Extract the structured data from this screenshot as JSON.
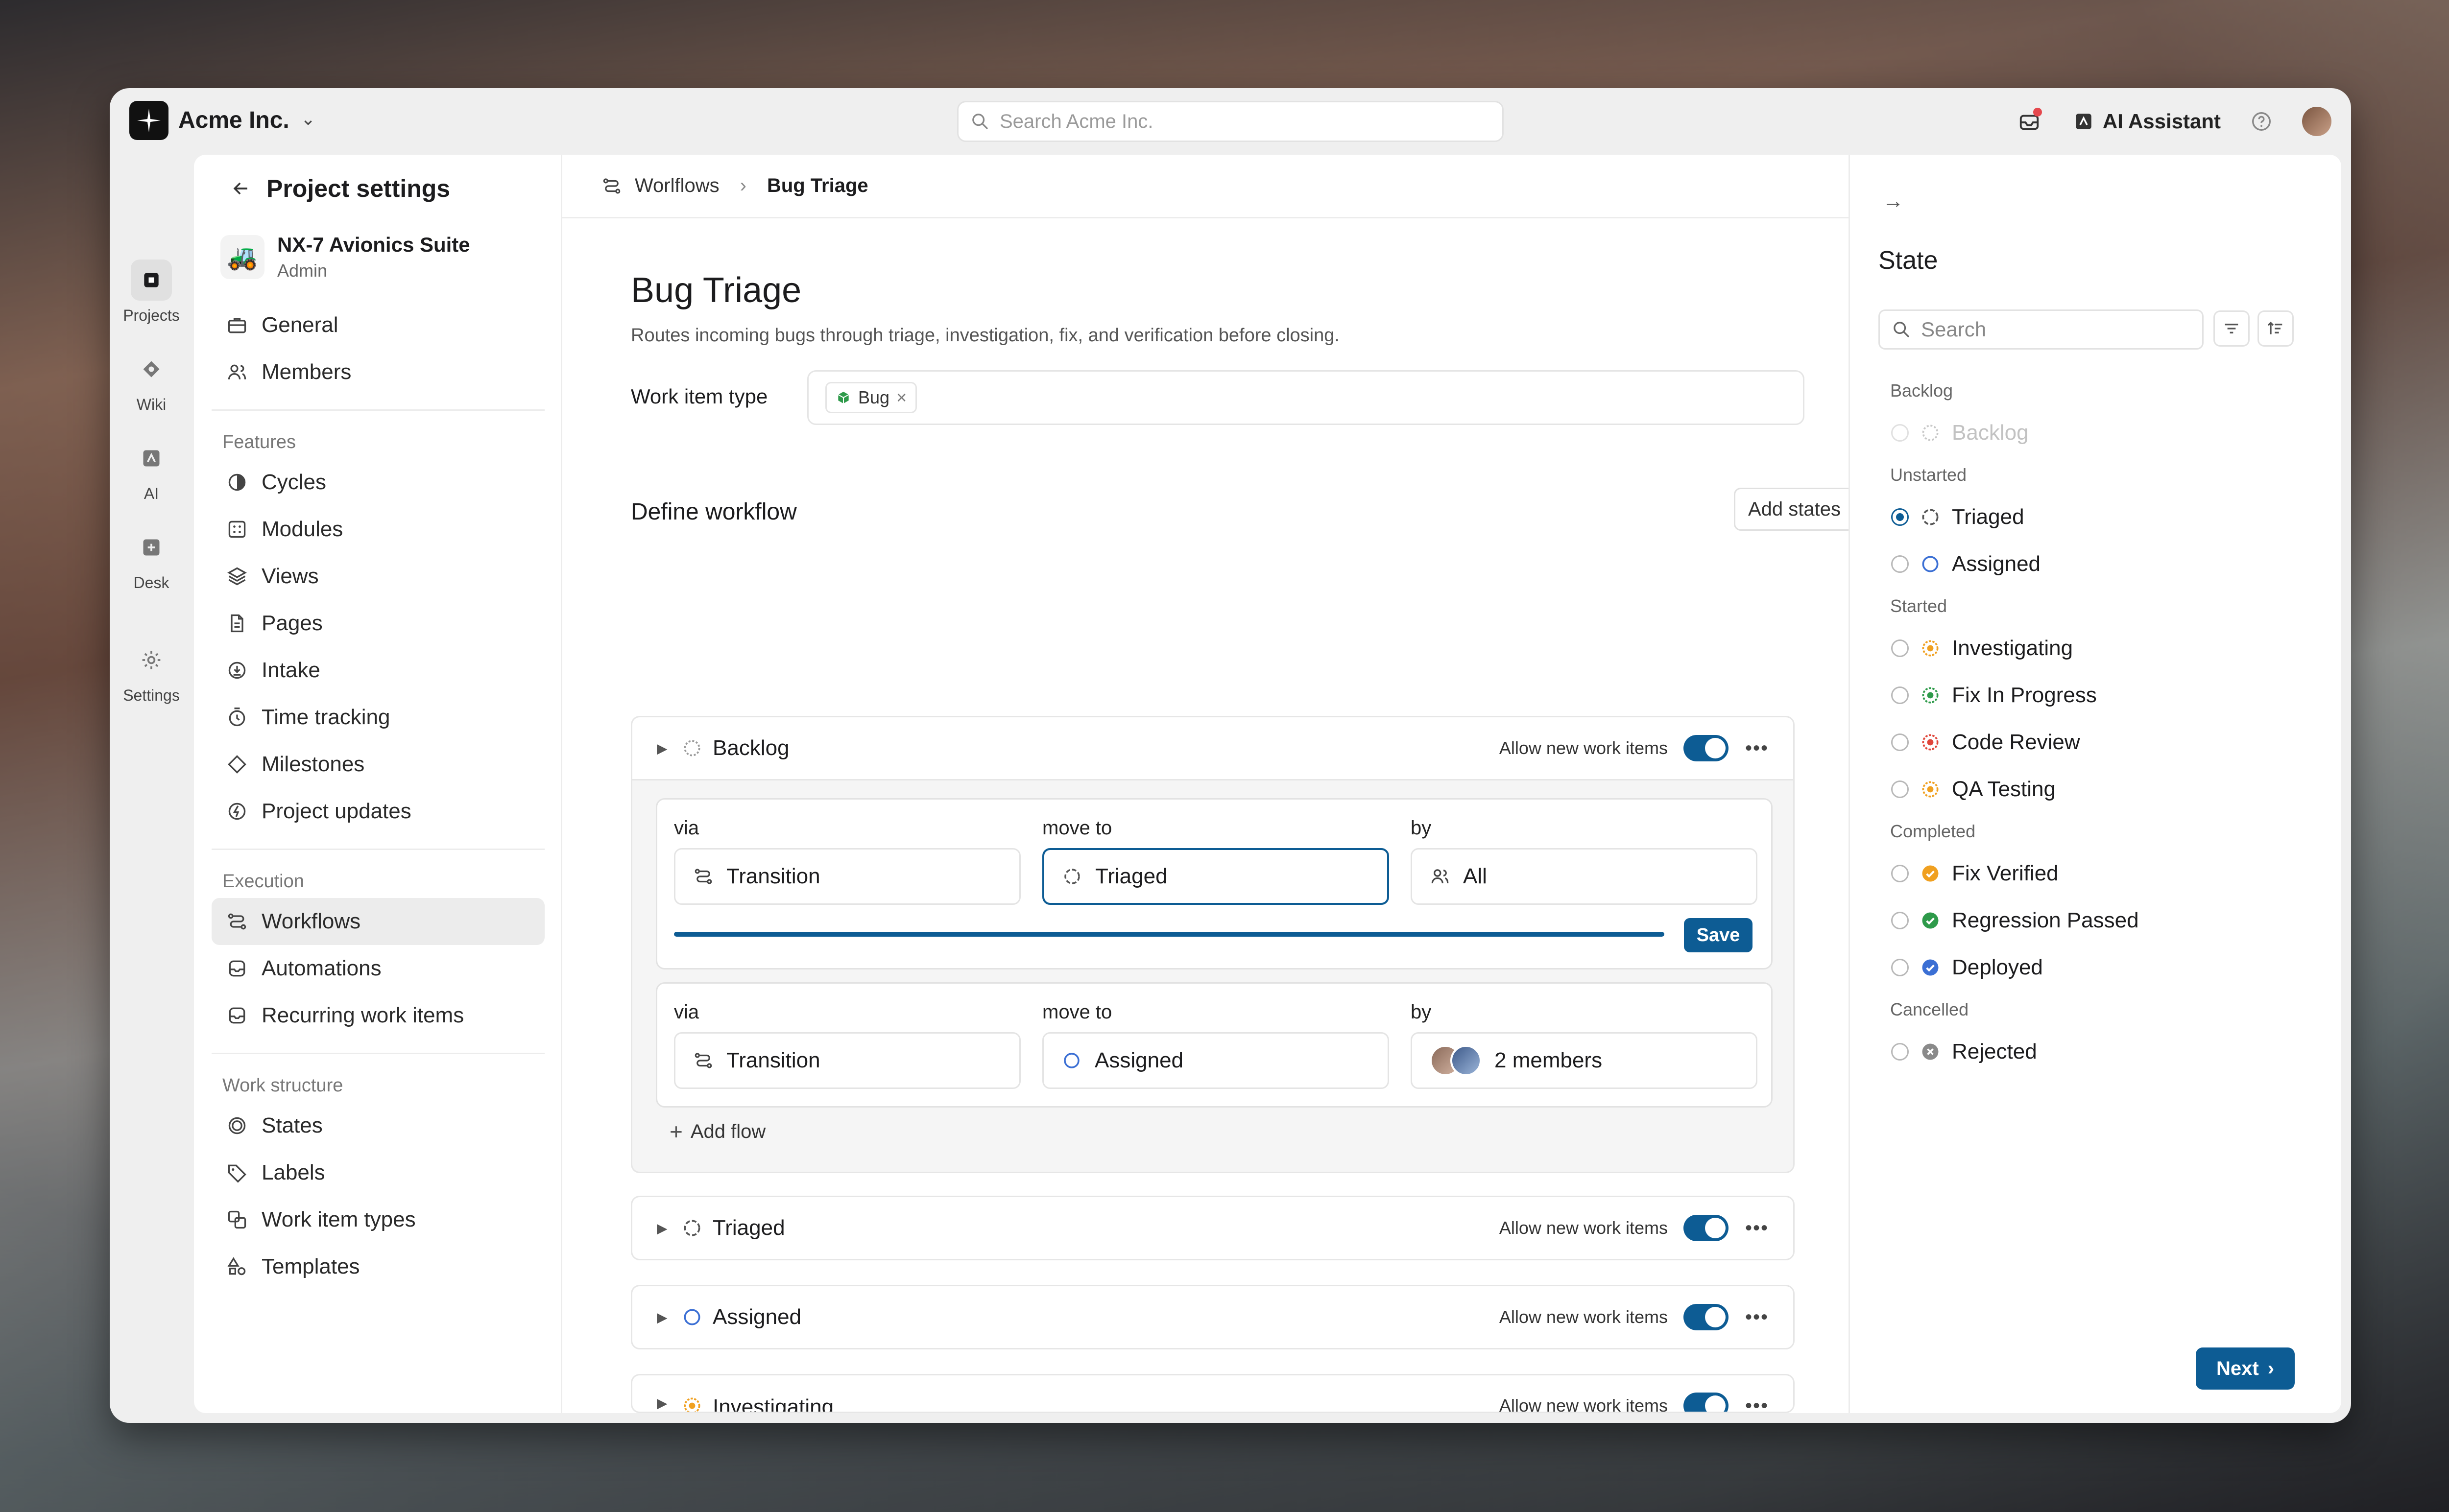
{
  "workspace": {
    "name": "Acme Inc."
  },
  "top_search": {
    "placeholder": "Search Acme Inc."
  },
  "top_right": {
    "ai_label": "AI Assistant"
  },
  "rail": [
    {
      "label": "Projects",
      "icon": "projects-icon",
      "active": true
    },
    {
      "label": "Wiki",
      "icon": "wiki-icon"
    },
    {
      "label": "AI",
      "icon": "ai-icon"
    },
    {
      "label": "Desk",
      "icon": "desk-icon"
    },
    {
      "label": "Settings",
      "icon": "settings-icon"
    }
  ],
  "sidebar": {
    "header": "Project settings",
    "project": {
      "name": "NX-7 Avionics Suite",
      "role": "Admin",
      "icon": "tractor-emoji"
    },
    "top_items": [
      "General",
      "Members"
    ],
    "features_label": "Features",
    "features": [
      "Cycles",
      "Modules",
      "Views",
      "Pages",
      "Intake",
      "Time tracking",
      "Milestones",
      "Project updates"
    ],
    "execution_label": "Execution",
    "execution": [
      "Workflows",
      "Automations",
      "Recurring work items"
    ],
    "structure_label": "Work structure",
    "structure": [
      "States",
      "Labels",
      "Work item types",
      "Templates"
    ]
  },
  "breadcrumb": {
    "parent": "Worlflows",
    "current": "Bug Triage"
  },
  "page": {
    "title": "Bug Triage",
    "description": "Routes incoming bugs through triage, investigation, fix, and verification before closing.",
    "work_item_type_label": "Work item type",
    "work_item_chip": "Bug",
    "define_title": "Define workflow",
    "add_states_label": "Add states",
    "allow_label": "Allow new work items"
  },
  "workflow_states": [
    {
      "name": "Backlog",
      "color": "#9a9a9a",
      "expanded": true
    },
    {
      "name": "Triaged",
      "color": "#555555"
    },
    {
      "name": "Assigned",
      "color": "#3b6fd4"
    },
    {
      "name": "Investigating",
      "color": "#f0a020"
    },
    {
      "name": "Fix In Progress",
      "color": "#2e9a4a"
    }
  ],
  "flows": [
    {
      "via_label": "via",
      "via": "Transition",
      "move_label": "move to",
      "move_to": "Triaged",
      "by_label": "by",
      "by": "All",
      "save_label": "Save",
      "progress": 1.0
    },
    {
      "via_label": "via",
      "via": "Transition",
      "move_label": "move to",
      "move_to": "Assigned",
      "by_label": "by",
      "by": "2 members"
    }
  ],
  "add_flow_label": "Add flow",
  "right_panel": {
    "title": "State",
    "search_placeholder": "Search",
    "groups": [
      {
        "label": "Backlog",
        "items": [
          {
            "name": "Backlog",
            "state": "disabled",
            "color": "#c8c8c8"
          }
        ]
      },
      {
        "label": "Unstarted",
        "items": [
          {
            "name": "Triaged",
            "state": "checked",
            "color": "#555555"
          },
          {
            "name": "Assigned",
            "color": "#3b6fd4"
          }
        ]
      },
      {
        "label": "Started",
        "items": [
          {
            "name": "Investigating",
            "color": "#f0a020"
          },
          {
            "name": "Fix In Progress",
            "color": "#2e9a4a"
          },
          {
            "name": "Code Review",
            "color": "#e0453a"
          },
          {
            "name": "QA Testing",
            "color": "#f0a020"
          }
        ]
      },
      {
        "label": "Completed",
        "items": [
          {
            "name": "Fix Verified",
            "color": "#f0a020"
          },
          {
            "name": "Regression Passed",
            "color": "#2e9a4a"
          },
          {
            "name": "Deployed",
            "color": "#3b6fd4"
          }
        ]
      },
      {
        "label": "Cancelled",
        "items": [
          {
            "name": "Rejected",
            "color": "#8a8a8a"
          }
        ]
      }
    ],
    "next_label": "Next"
  }
}
